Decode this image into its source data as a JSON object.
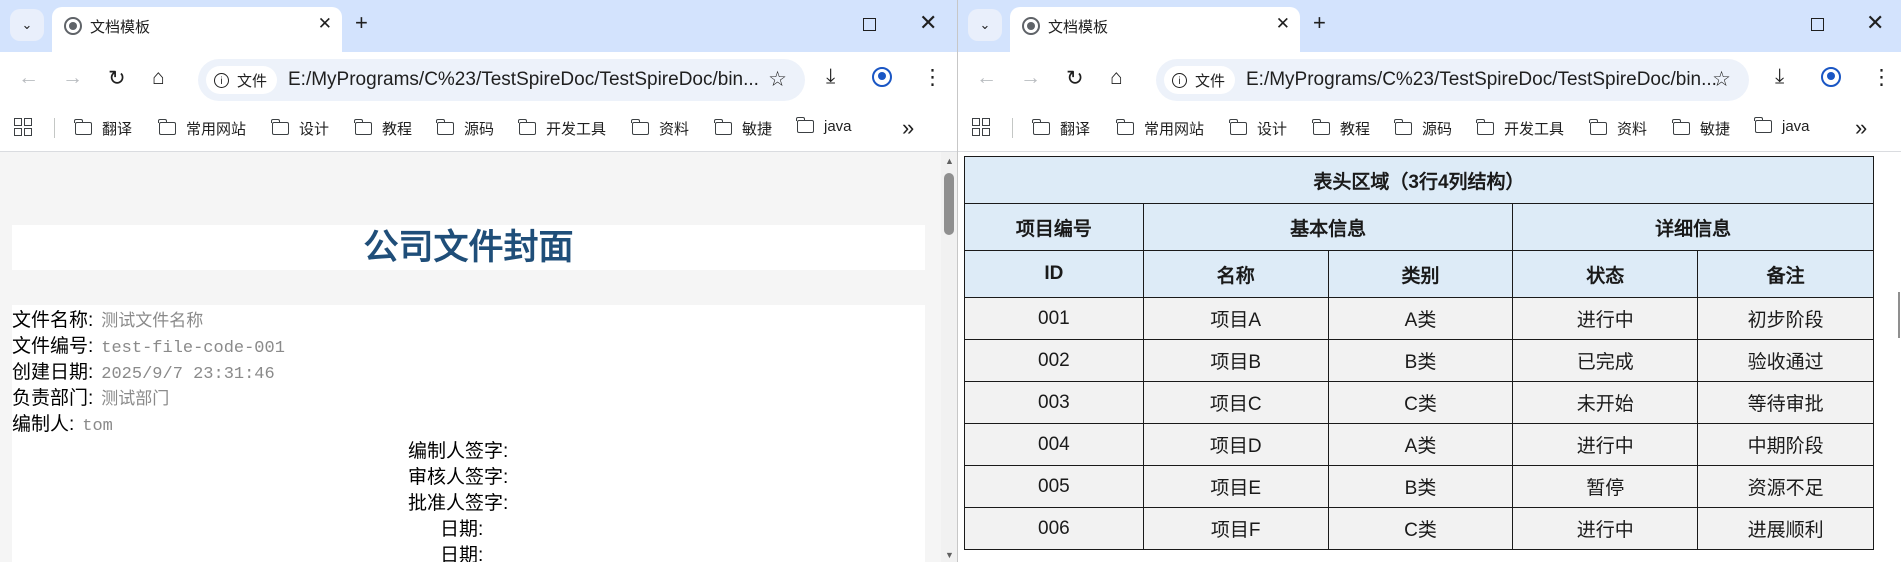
{
  "left_window": {
    "tab_title": "文档模板",
    "chip_label": "文件",
    "url": "E:/MyPrograms/C%23/TestSpireDoc/TestSpireDoc/bin...",
    "bookmarks": [
      "翻译",
      "常用网站",
      "设计",
      "教程",
      "源码",
      "开发工具",
      "资料",
      "敏捷",
      "java"
    ],
    "cover_title": "公司文件封面",
    "fields": [
      {
        "label": "文件名称:",
        "value": "测试文件名称"
      },
      {
        "label": "文件编号:",
        "value": "test-file-code-001"
      },
      {
        "label": "创建日期:",
        "value": "2025/9/7 23:31:46"
      },
      {
        "label": "负责部门:",
        "value": "测试部门"
      },
      {
        "label": "编制人:",
        "value": "tom"
      }
    ],
    "signatures": [
      "编制人签字:",
      "审核人签字:",
      "批准人签字:",
      "日期:",
      "日期:"
    ]
  },
  "right_window": {
    "tab_title": "文档模板",
    "chip_label": "文件",
    "url": "E:/MyPrograms/C%23/TestSpireDoc/TestSpireDoc/bin...",
    "bookmarks": [
      "翻译",
      "常用网站",
      "设计",
      "教程",
      "源码",
      "开发工具",
      "资料",
      "敏捷",
      "java"
    ],
    "table": {
      "caption": "表头区域（3行4列结构）",
      "group_headers": [
        "项目编号",
        "基本信息",
        "详细信息"
      ],
      "columns": [
        "ID",
        "名称",
        "类别",
        "状态",
        "备注"
      ],
      "rows": [
        [
          "001",
          "项目A",
          "A类",
          "进行中",
          "初步阶段"
        ],
        [
          "002",
          "项目B",
          "B类",
          "已完成",
          "验收通过"
        ],
        [
          "003",
          "项目C",
          "C类",
          "未开始",
          "等待审批"
        ],
        [
          "004",
          "项目D",
          "A类",
          "进行中",
          "中期阶段"
        ],
        [
          "005",
          "项目E",
          "B类",
          "暂停",
          "资源不足"
        ],
        [
          "006",
          "项目F",
          "C类",
          "进行中",
          "进展顺利"
        ]
      ]
    }
  },
  "icons": {
    "tab_search": "chevron-down-icon",
    "favicon": "globe-icon",
    "tab_close": "close-icon",
    "new_tab": "plus-icon",
    "maximize": "maximize-icon",
    "window_close": "close-icon",
    "back": "arrow-left-icon",
    "forward": "arrow-right-icon",
    "reload": "reload-icon",
    "home": "home-icon",
    "info": "info-icon",
    "bookmark_star": "star-icon",
    "download": "download-icon",
    "account": "account-icon",
    "menu": "kebab-menu-icon",
    "apps": "apps-grid-icon",
    "folder": "folder-icon",
    "more_bookmarks": "double-chevron-right-icon"
  },
  "colors": {
    "titlebar_bg": "#d3e3fd",
    "omnibox_bg": "#edf2fa",
    "cover_title": "#1f4e79",
    "header_cell_bg": "#ddebf7",
    "body_cell_bg": "#f2f2f2",
    "field_value": "#8a8a8a"
  }
}
